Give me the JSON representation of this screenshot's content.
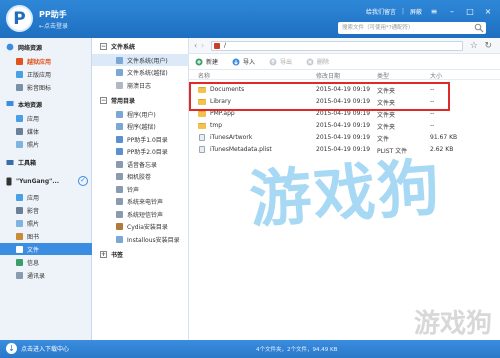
{
  "app": {
    "logo_glyph": "P",
    "name": "PP助手",
    "login_link": "←点击登录",
    "feedback": "给我们留言",
    "mode": "屏蔽",
    "search_placeholder": "搜索文件（可使用*?通配符）"
  },
  "leftnav": {
    "sections": [
      {
        "title": "网络资源",
        "items": [
          "越狱应用",
          "正版应用",
          "影音图标"
        ]
      },
      {
        "title": "本地资源",
        "items": [
          "应用",
          "媒体",
          "照片"
        ]
      },
      {
        "title": "工具箱",
        "items": []
      }
    ],
    "device": {
      "name": "\"YunGang\"...",
      "items": [
        "应用",
        "影音",
        "照片",
        "图书",
        "文件",
        "信息",
        "通讯录"
      ]
    },
    "active_item": "文件"
  },
  "tree": {
    "groups": [
      {
        "title": "文件系统",
        "items": [
          "文件系统(用户)",
          "文件系统(越狱)",
          "崩溃日志"
        ]
      },
      {
        "title": "常用目录",
        "items": [
          "程序(用户)",
          "程序(越狱)",
          "PP助手1.0目录",
          "PP助手2.0目录",
          "语音备忘录",
          "相机胶卷",
          "铃声",
          "系统来电铃声",
          "系统短信铃声",
          "Cydia安装目录",
          "Installous安装目录"
        ]
      },
      {
        "title": "书签",
        "items": []
      }
    ],
    "selected": "文件系统(用户)"
  },
  "main": {
    "path": "/",
    "toolbar": {
      "new": "新建",
      "import": "导入",
      "export": "导出",
      "delete": "删除"
    },
    "columns": {
      "name": "名称",
      "modified": "修改日期",
      "type": "类型",
      "size": "大小"
    },
    "rows": [
      {
        "name": "Documents",
        "modified": "2015-04-19 09:19",
        "type": "文件夹",
        "size": "--",
        "kind": "folder"
      },
      {
        "name": "Library",
        "modified": "2015-04-19 09:19",
        "type": "文件夹",
        "size": "--",
        "kind": "folder"
      },
      {
        "name": "PMP.app",
        "modified": "2015-04-19 09:19",
        "type": "文件夹",
        "size": "--",
        "kind": "folder"
      },
      {
        "name": "tmp",
        "modified": "2015-04-19 09:19",
        "type": "文件夹",
        "size": "--",
        "kind": "folder"
      },
      {
        "name": "iTunesArtwork",
        "modified": "2015-04-19 09:19",
        "type": "文件",
        "size": "91.67 KB",
        "kind": "file"
      },
      {
        "name": "iTunesMetadata.plist",
        "modified": "2015-04-19 09:19",
        "type": "PLIST 文件",
        "size": "2.62 KB",
        "kind": "file"
      }
    ],
    "watermark": "游戏狗",
    "corner_watermark": "游戏狗"
  },
  "status": {
    "download_center": "点击进入下载中心",
    "summary": "4个文件夹，2个文件，94.49 KB"
  },
  "colors": {
    "accent": "#2f87d8",
    "highlight": "#e02a2a",
    "hot": "#e0531f"
  }
}
